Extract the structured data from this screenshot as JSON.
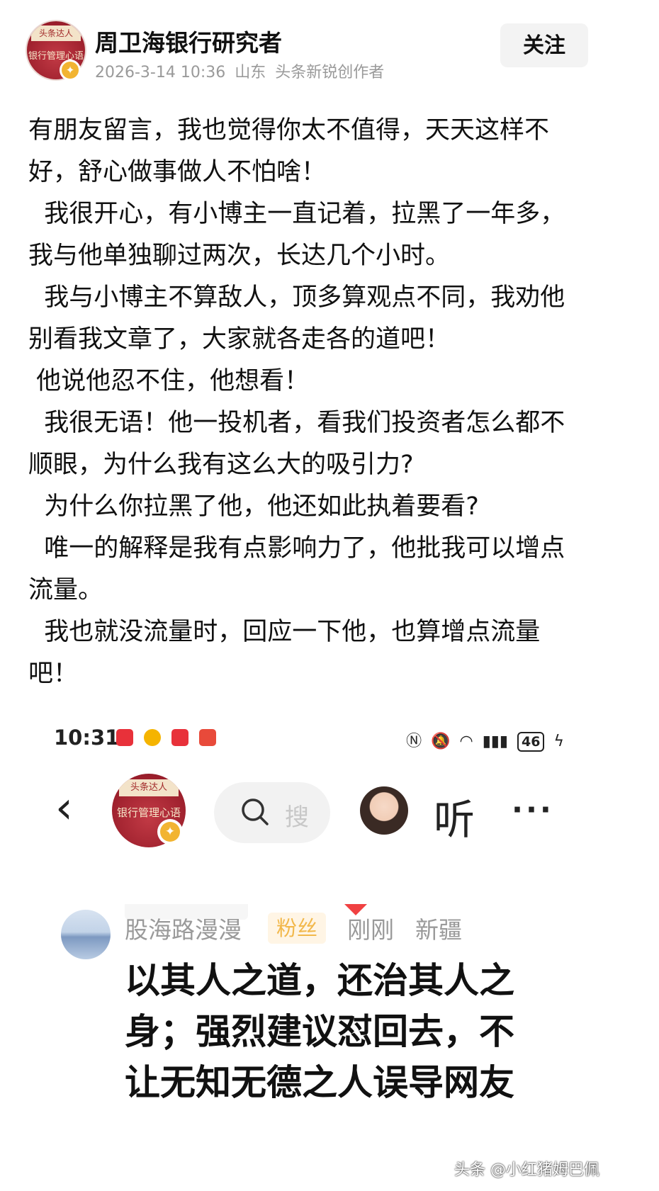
{
  "post": {
    "author": "周卫海银行研究者",
    "datetime": "2026-3-14 10:36",
    "location": "山东",
    "title": "头条新锐创作者",
    "follow_label": "关注",
    "avatar_text_top": "头条达人",
    "avatar_text_book": "银行管理心语"
  },
  "article": {
    "paragraphs": [
      "有朋友留言，我也觉得你太不值得，天天这样不好，舒心做事做人不怕啥！",
      "  我很开心，有小博主一直记着，拉黑了一年多，我与他单独聊过两次，长达几个小时。",
      "  我与小博主不算敌人，顶多算观点不同，我劝他别看我文章了，大家就各走各的道吧！",
      " 他说他忍不住，他想看！",
      "  我很无语！他一投机者，看我们投资者怎么都不顺眼，为什么我有这么大的吸引力?",
      "  为什么你拉黑了他，他还如此执着要看?",
      "  唯一的解释是我有点影响力了，他批我可以增点流量。",
      "  我也就没流量时，回应一下他，也算增点流量吧！"
    ]
  },
  "embed": {
    "status": {
      "time": "10:31",
      "signal": "4G",
      "battery": "46",
      "app_icon_colors": [
        "#e8313a",
        "#f5b400",
        "#e8313a",
        "#e8313a"
      ]
    },
    "nav": {
      "back_icon": "chevron-left-icon",
      "search_hint": "搜",
      "listen_label": "听",
      "more_label": "···"
    },
    "comment": {
      "user": "股海路漫漫",
      "tag": "粉丝",
      "time": "刚刚",
      "location": "新疆",
      "text": "以其人之道，还治其人之身；强烈建议怼回去，不让无知无德之人误导网友"
    }
  },
  "watermark": "头条 @小红猪姆巴佩",
  "colors": {
    "badge": "#f2b431",
    "tag_bg": "#fff5e5",
    "tag_text": "#f2b84b",
    "meta_gray": "#9a9a9a"
  }
}
